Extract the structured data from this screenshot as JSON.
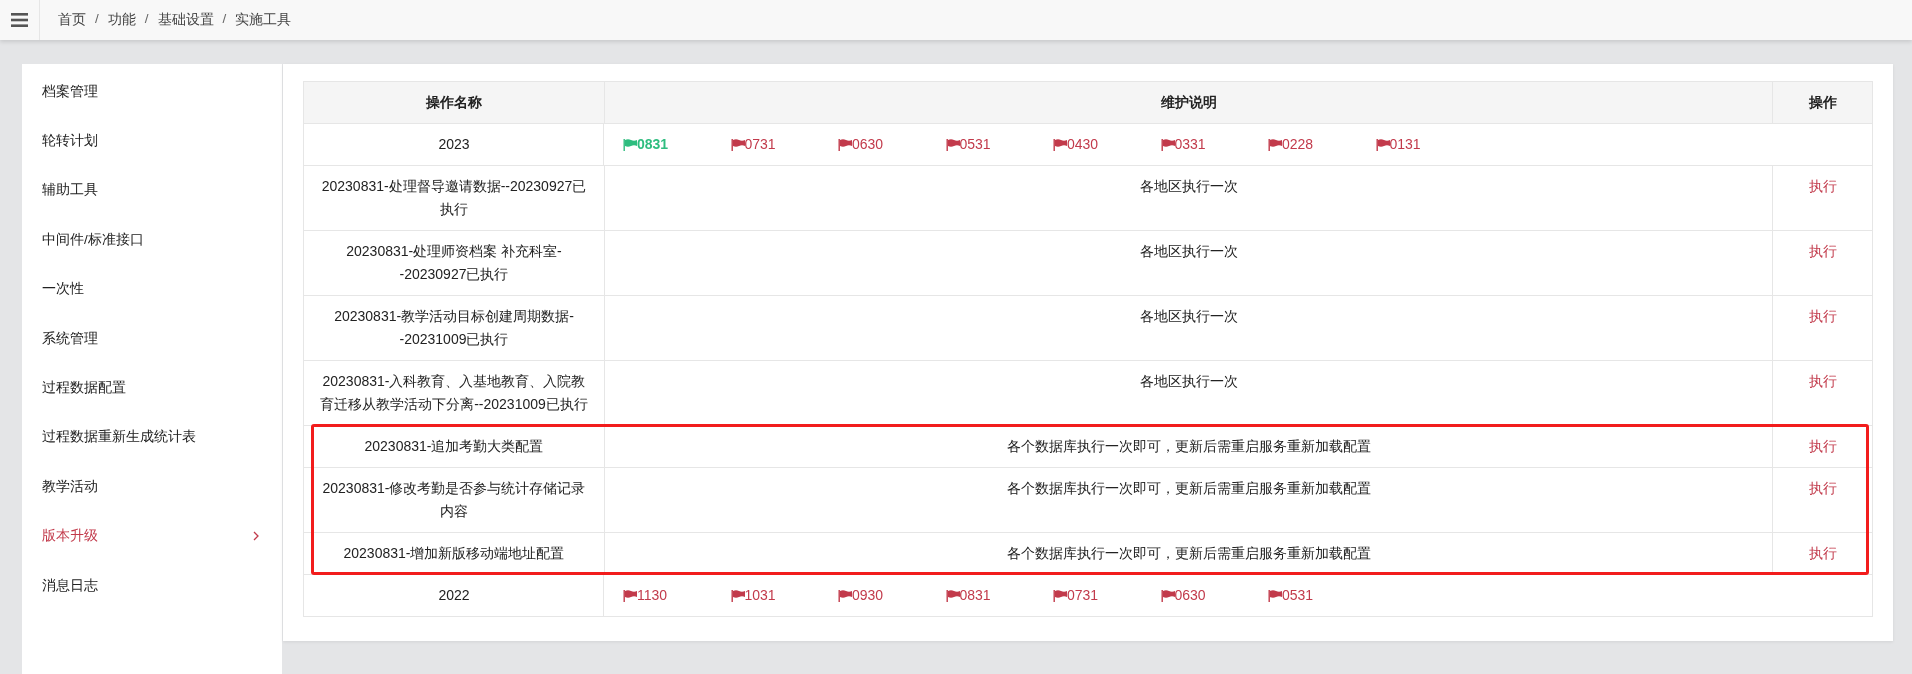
{
  "breadcrumb": {
    "separator": "/",
    "items": [
      "首页",
      "功能",
      "基础设置",
      "实施工具"
    ]
  },
  "sidebar": {
    "items": [
      {
        "label": "档案管理",
        "selected": false
      },
      {
        "label": "轮转计划",
        "selected": false
      },
      {
        "label": "辅助工具",
        "selected": false
      },
      {
        "label": "中间件/标准接口",
        "selected": false
      },
      {
        "label": "一次性",
        "selected": false
      },
      {
        "label": "系统管理",
        "selected": false
      },
      {
        "label": "过程数据配置",
        "selected": false
      },
      {
        "label": "过程数据重新生成统计表",
        "selected": false
      },
      {
        "label": "教学活动",
        "selected": false
      },
      {
        "label": "版本升级",
        "selected": true
      },
      {
        "label": "消息日志",
        "selected": false
      }
    ]
  },
  "table": {
    "columns": [
      "操作名称",
      "维护说明",
      "操作"
    ],
    "rows": [
      {
        "kind": "year",
        "name": "2023",
        "highlighted": false,
        "tags": [
          {
            "label": "0831",
            "selected": true
          },
          {
            "label": "0731",
            "selected": false
          },
          {
            "label": "0630",
            "selected": false
          },
          {
            "label": "0531",
            "selected": false
          },
          {
            "label": "0430",
            "selected": false
          },
          {
            "label": "0331",
            "selected": false
          },
          {
            "label": "0228",
            "selected": false
          },
          {
            "label": "0131",
            "selected": false
          }
        ]
      },
      {
        "kind": "task",
        "name": "20230831-处理督导邀请数据--20230927已执行",
        "description": "各地区执行一次",
        "action": "执行",
        "highlighted": false
      },
      {
        "kind": "task",
        "name": "20230831-处理师资档案 补充科室--20230927已执行",
        "description": "各地区执行一次",
        "action": "执行",
        "highlighted": false
      },
      {
        "kind": "task",
        "name": "20230831-教学活动目标创建周期数据--20231009已执行",
        "description": "各地区执行一次",
        "action": "执行",
        "highlighted": false
      },
      {
        "kind": "task",
        "name": "20230831-入科教育、入基地教育、入院教育迁移从教学活动下分离--20231009已执行",
        "description": "各地区执行一次",
        "action": "执行",
        "highlighted": false
      },
      {
        "kind": "task",
        "name": "20230831-追加考勤大类配置",
        "description": "各个数据库执行一次即可，更新后需重启服务重新加载配置",
        "action": "执行",
        "highlighted": true
      },
      {
        "kind": "task",
        "name": "20230831-修改考勤是否参与统计存储记录内容",
        "description": "各个数据库执行一次即可，更新后需重启服务重新加载配置",
        "action": "执行",
        "highlighted": true
      },
      {
        "kind": "task",
        "name": "20230831-增加新版移动端地址配置",
        "description": "各个数据库执行一次即可，更新后需重启服务重新加载配置",
        "action": "执行",
        "highlighted": true
      },
      {
        "kind": "year",
        "name": "2022",
        "highlighted": false,
        "tags": [
          {
            "label": "1130",
            "selected": false
          },
          {
            "label": "1031",
            "selected": false
          },
          {
            "label": "0930",
            "selected": false
          },
          {
            "label": "0831",
            "selected": false
          },
          {
            "label": "0731",
            "selected": false
          },
          {
            "label": "0630",
            "selected": false
          },
          {
            "label": "0531",
            "selected": false
          }
        ]
      }
    ]
  }
}
